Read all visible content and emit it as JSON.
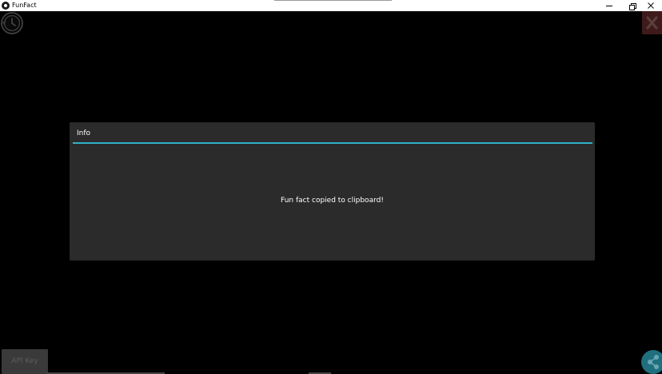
{
  "window": {
    "title": "FunFact"
  },
  "dialog": {
    "title": "Info",
    "message": "Fun fact copied to clipboard!",
    "accent_color": "#31b1c7"
  },
  "footer": {
    "api_key_label": "API Key"
  },
  "icons": {
    "history": "history-icon",
    "close": "close-icon",
    "share": "share-icon"
  },
  "colors": {
    "background": "#000000",
    "dialog_background": "#2b2b2b",
    "share_button": "#1f6f7f"
  }
}
